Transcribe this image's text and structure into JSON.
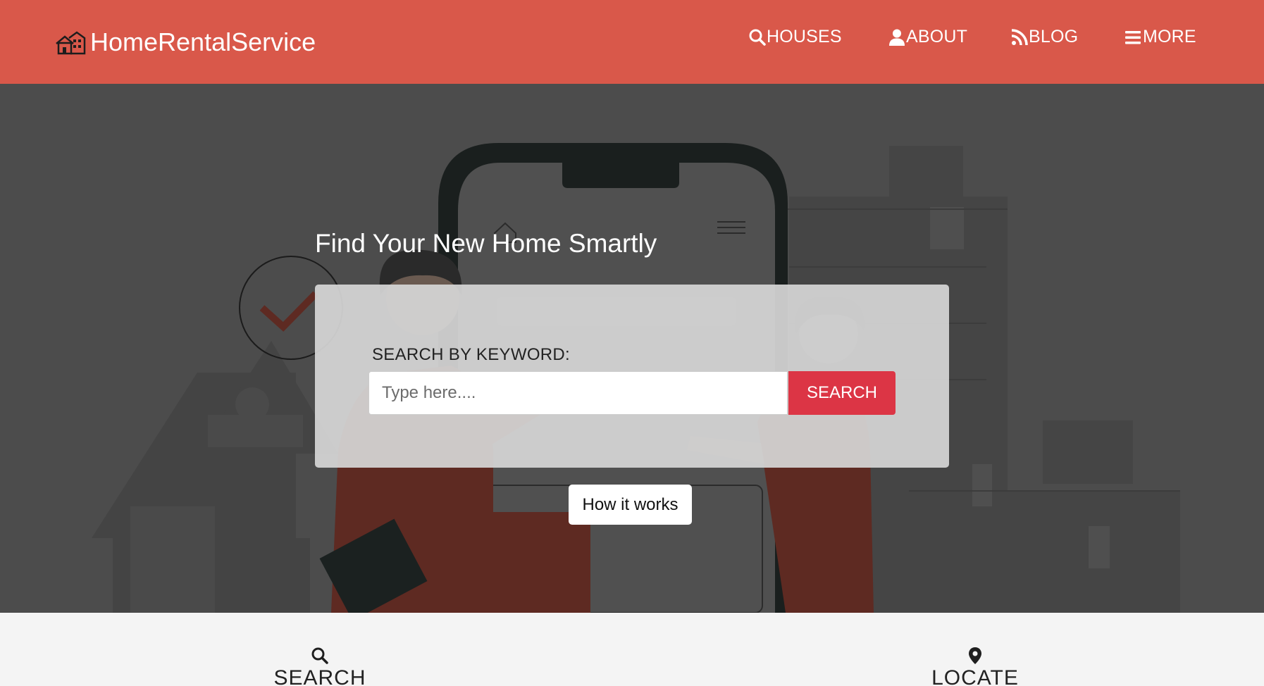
{
  "nav": {
    "brand": "HomeRentalService",
    "links": [
      {
        "label": "HOUSES",
        "icon": "search-icon"
      },
      {
        "label": "ABOUT",
        "icon": "user-icon"
      },
      {
        "label": "BLOG",
        "icon": "rss-icon"
      },
      {
        "label": "MORE",
        "icon": "menu-icon"
      }
    ]
  },
  "hero": {
    "heading": "Find Your New Home Smartly",
    "search_label": "SEARCH BY KEYWORD:",
    "search_placeholder": "Type here....",
    "search_button": "SEARCH",
    "how_button": "How it works"
  },
  "features": [
    {
      "title": "SEARCH",
      "icon": "search-icon"
    },
    {
      "title": "LOCATE",
      "icon": "map-pin-icon"
    }
  ],
  "colors": {
    "navbar": "#d9584a",
    "hero_bg": "#4c4c4c",
    "search_button": "#dc3545",
    "illustration_accent": "#5e2a22"
  }
}
